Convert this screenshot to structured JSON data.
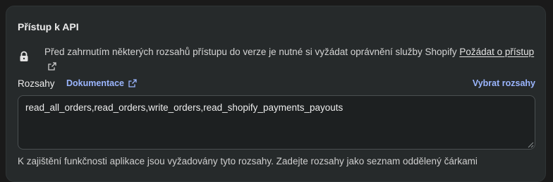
{
  "section": {
    "title": "Přístup k API"
  },
  "notice": {
    "icon": "lock-icon",
    "text": "Před zahrnutím některých rozsahů přístupu do verze je nutné si vyžádat oprávnění služby Shopify",
    "link_label": "Požádat o přístup"
  },
  "scopes": {
    "label": "Rozsahy",
    "docs_link": "Dokumentace",
    "select_link": "Vybrat rozsahy",
    "value": "read_all_orders,read_orders,write_orders,read_shopify_payments_payouts",
    "help_text": "K zajištění funkčnosti aplikace jsou vyžadovány tyto rozsahy. Zadejte rozsahy jako seznam oddělený čárkami"
  },
  "colors": {
    "background": "#1a1a1a",
    "card": "#262a2b",
    "link_accent": "#9bb6ff"
  }
}
